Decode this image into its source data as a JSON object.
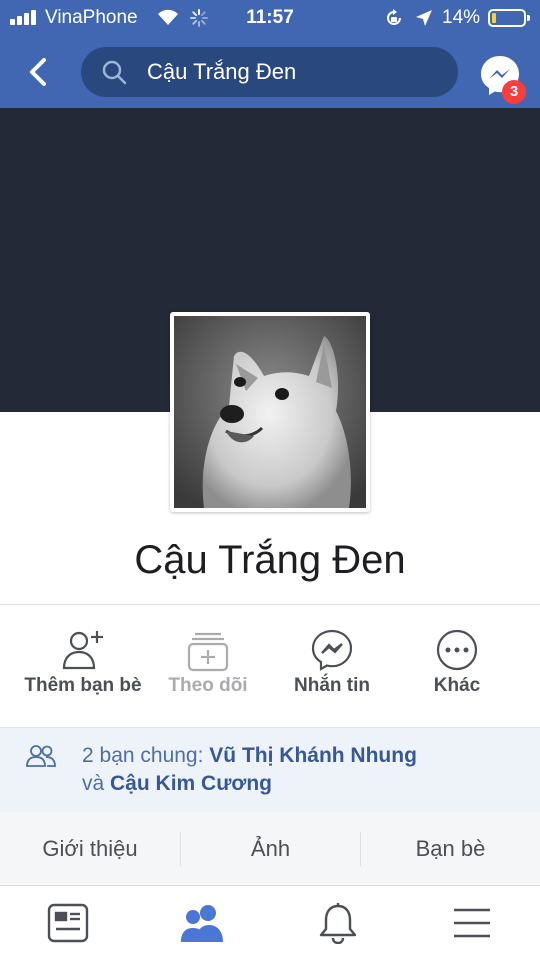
{
  "status_bar": {
    "carrier": "VinaPhone",
    "time": "11:57",
    "battery_percent": "14%",
    "battery_level": 0.14,
    "icons": [
      "signal-icon",
      "wifi-icon",
      "activity-spinner-icon",
      "rotation-lock-icon",
      "location-arrow-icon",
      "battery-icon"
    ]
  },
  "nav": {
    "back_icon": "chevron-left-icon",
    "search_value": "Cậu Trắng Đen",
    "messenger_icon": "messenger-icon",
    "messenger_badge": "3"
  },
  "profile": {
    "name": "Cậu Trắng Đen",
    "avatar": "shiba-dog-photo"
  },
  "actions": [
    {
      "label": "Thêm bạn bè",
      "icon": "add-friend-icon",
      "enabled": true
    },
    {
      "label": "Theo dõi",
      "icon": "follow-icon",
      "enabled": false
    },
    {
      "label": "Nhắn tin",
      "icon": "messenger-icon",
      "enabled": true
    },
    {
      "label": "Khác",
      "icon": "more-icon",
      "enabled": true
    }
  ],
  "mutual": {
    "prefix": "2 bạn chung: ",
    "friend1": "Vũ Thị Khánh Nhung",
    "conjunction": "và ",
    "friend2": "Cậu Kim Cương",
    "icon": "people-icon"
  },
  "tabs": [
    "Giới thiệu",
    "Ảnh",
    "Bạn bè"
  ],
  "bottom_nav": [
    {
      "icon": "news-feed-icon",
      "active": false
    },
    {
      "icon": "friends-icon",
      "active": true
    },
    {
      "icon": "notifications-bell-icon",
      "active": false
    },
    {
      "icon": "menu-icon",
      "active": false
    }
  ],
  "colors": {
    "brand": "#4267b2",
    "search_bg": "#29487d",
    "cover": "#242937",
    "badge": "#fa3e3e",
    "link": "#365899",
    "active_tab": "#4a76d6"
  }
}
